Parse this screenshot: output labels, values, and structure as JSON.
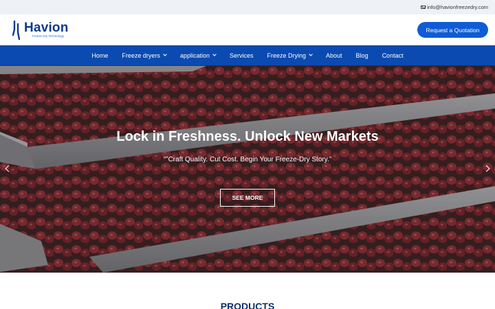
{
  "topbar": {
    "email": "info@havionfreezedry.com",
    "icon": "mail-icon"
  },
  "header": {
    "logo_name": "Havion",
    "logo_tagline": "Freeze Dry Technology",
    "cta_label": "Request a Quotation"
  },
  "nav": {
    "items": [
      {
        "label": "Home",
        "dropdown": false
      },
      {
        "label": "Freeze dryers",
        "dropdown": true
      },
      {
        "label": "application",
        "dropdown": true
      },
      {
        "label": "Services",
        "dropdown": false
      },
      {
        "label": "Freeze Drying",
        "dropdown": true
      },
      {
        "label": "About",
        "dropdown": false
      },
      {
        "label": "Blog",
        "dropdown": false
      },
      {
        "label": "Contact",
        "dropdown": false
      }
    ]
  },
  "hero": {
    "title": "Lock in Freshness. Unlock New Markets",
    "subtitle": "“”Craft Quality. Cut Cost. Begin Your Freeze-Dry Story.”",
    "button_label": "SEE MORE"
  },
  "products": {
    "title": "PRODUCTS"
  },
  "colors": {
    "brand_blue": "#0b4ab0",
    "cta_blue": "#0e5cd6",
    "heading_navy": "#0d2f6e"
  }
}
